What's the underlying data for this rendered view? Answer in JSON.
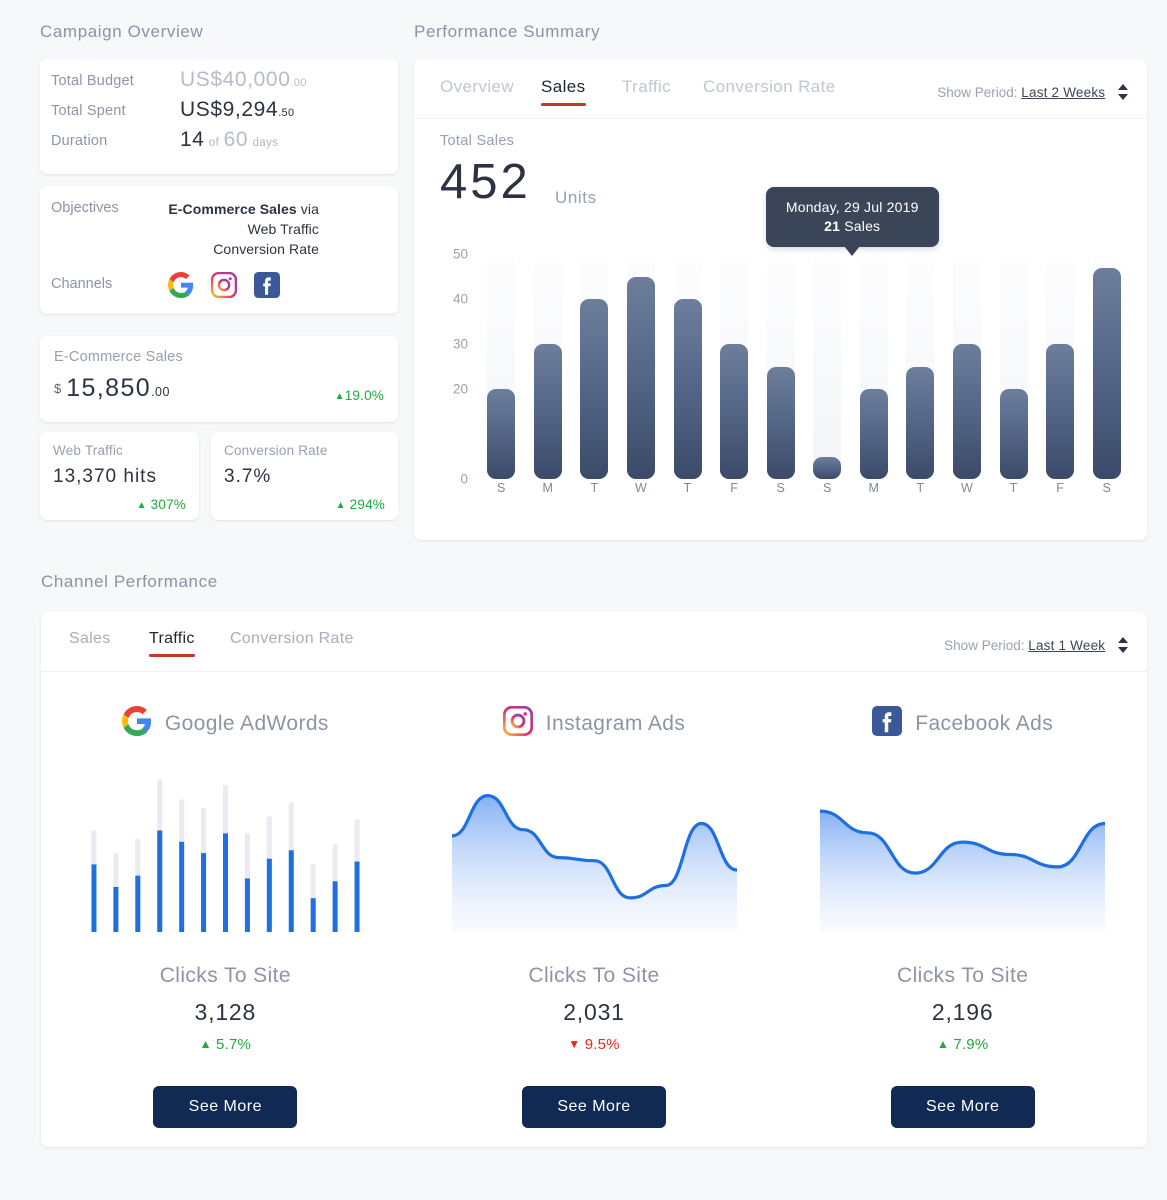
{
  "sections": {
    "campaign_overview": "Campaign Overview",
    "performance_summary": "Performance Summary",
    "channel_performance": "Channel Performance"
  },
  "budget_card": {
    "rows": [
      {
        "label": "Total Budget",
        "amount": "US$40,000",
        "cents": ".00",
        "muted": true
      },
      {
        "label": "Total Spent",
        "amount": "US$9,294",
        "cents": ".50",
        "muted": false
      }
    ],
    "duration": {
      "label": "Duration",
      "elapsed": "14",
      "of": "of",
      "total": "60",
      "unit": "days"
    }
  },
  "objectives_card": {
    "objectives_label": "Objectives",
    "primary": "E-Commerce Sales",
    "via": " via",
    "secondary": [
      "Web Traffic",
      "Conversion Rate"
    ],
    "channels_label": "Channels",
    "channels": [
      "google-icon",
      "instagram-icon",
      "facebook-icon"
    ]
  },
  "ecommerce_card": {
    "label": "E-Commerce Sales",
    "currency": "$",
    "value": "15,850",
    "cents": ".00",
    "delta": "19.0%",
    "delta_dir": "up"
  },
  "web_traffic_card": {
    "label": "Web Traffic",
    "value": "13,370 hits",
    "delta": "307%",
    "delta_dir": "up"
  },
  "conversion_card": {
    "label": "Conversion Rate",
    "value": "3.7%",
    "delta": "294%",
    "delta_dir": "up"
  },
  "performance": {
    "tabs": [
      {
        "label": "Overview",
        "active": false
      },
      {
        "label": "Sales",
        "active": true
      },
      {
        "label": "Traffic",
        "active": false
      },
      {
        "label": "Conversion Rate",
        "active": false
      }
    ],
    "period_label": "Show Period:",
    "period_value": "Last 2 Weeks",
    "total_sales_label": "Total Sales",
    "total_sales_value": "452",
    "total_sales_unit": "Units",
    "tooltip": {
      "date": "Monday, 29 Jul 2019",
      "value": "21",
      "unit": "Sales"
    }
  },
  "chart_data": {
    "type": "bar",
    "title": "Total Sales",
    "xlabel": "",
    "ylabel": "Units",
    "categories": [
      "S",
      "M",
      "T",
      "W",
      "T",
      "F",
      "S",
      "S",
      "M",
      "T",
      "W",
      "T",
      "F",
      "S"
    ],
    "values": [
      20,
      30,
      40,
      45,
      40,
      30,
      25,
      5,
      20,
      25,
      30,
      20,
      30,
      47
    ],
    "ylim": [
      0,
      50
    ],
    "yticks": [
      "0",
      "20",
      "30",
      "40",
      "50"
    ],
    "ytick_values": [
      0,
      20,
      30,
      40,
      50
    ],
    "grid": false,
    "legend": "none",
    "highlight_index": 8,
    "highlight_label": "Monday, 29 Jul 2019",
    "highlight_value": 21
  },
  "channel": {
    "tabs": [
      {
        "label": "Sales",
        "active": false
      },
      {
        "label": "Traffic",
        "active": true
      },
      {
        "label": "Conversion Rate",
        "active": false
      }
    ],
    "period_label": "Show Period:",
    "period_value": "Last 1 Week",
    "columns": [
      {
        "icon": "google-icon",
        "name": "Google AdWords",
        "metric_label": "Clicks To Site",
        "metric_value": "3,128",
        "delta": "5.7%",
        "delta_dir": "up",
        "button": "See More",
        "chart": {
          "type": "bar",
          "values": [
            48,
            32,
            40,
            72,
            64,
            56,
            70,
            38,
            52,
            58,
            24,
            36,
            50
          ],
          "track_values": [
            72,
            56,
            66,
            108,
            94,
            88,
            104,
            70,
            82,
            92,
            48,
            62,
            80
          ],
          "ymax": 110
        }
      },
      {
        "icon": "instagram-icon",
        "name": "Instagram Ads",
        "metric_label": "Clicks To Site",
        "metric_value": "2,031",
        "delta": "9.5%",
        "delta_dir": "down",
        "button": "See More",
        "chart": {
          "type": "area",
          "x": [
            0,
            1,
            2,
            3,
            4,
            5,
            6,
            7,
            8
          ],
          "values": [
            62,
            88,
            66,
            48,
            46,
            22,
            30,
            70,
            40
          ],
          "ymax": 100
        }
      },
      {
        "icon": "facebook-icon",
        "name": "Facebook Ads",
        "metric_label": "Clicks To Site",
        "metric_value": "2,196",
        "delta": "7.9%",
        "delta_dir": "up",
        "button": "See More",
        "chart": {
          "type": "area",
          "x": [
            0,
            1,
            2,
            3,
            4,
            5,
            6
          ],
          "values": [
            78,
            64,
            38,
            58,
            50,
            42,
            70
          ],
          "ymax": 100
        }
      }
    ]
  },
  "colors": {
    "accent_red": "#c0392b",
    "bar_top": "#6d7e9c",
    "bar_bottom": "#3b4a68",
    "tooltip_bg": "#3a4558",
    "button_bg": "#102a54",
    "up_green": "#1faa3c",
    "down_red": "#e8281c",
    "line_blue": "#1f6fe0",
    "page_bg": "#f7f8fa"
  }
}
